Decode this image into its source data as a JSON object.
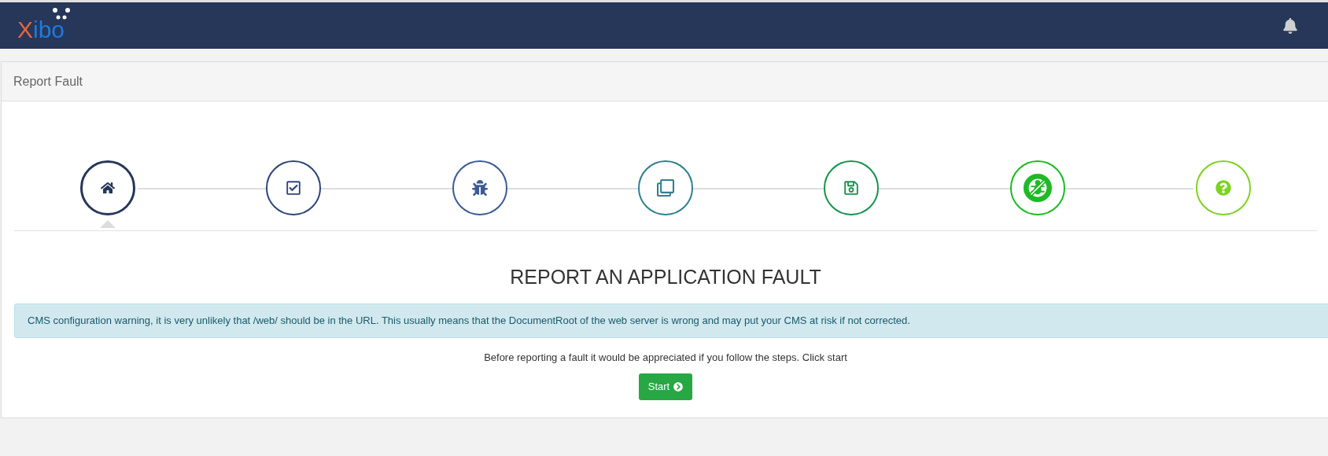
{
  "navbar": {
    "logo": "Xibo"
  },
  "panel": {
    "title": "Report Fault"
  },
  "steps": [
    {
      "color": "#263759",
      "selected": true
    },
    {
      "color": "#2e4677",
      "selected": false
    },
    {
      "color": "#3d5a95",
      "selected": false
    },
    {
      "color": "#2f7f8f",
      "selected": false
    },
    {
      "color": "#16934f",
      "selected": false
    },
    {
      "color": "#1dba25",
      "selected": false
    },
    {
      "color": "#7ed321",
      "selected": false
    }
  ],
  "heading": "REPORT AN APPLICATION FAULT",
  "alert": "CMS configuration warning, it is very unlikely that /web/ should be in the URL. This usually means that the DocumentRoot of the web server is wrong and may put your CMS at risk if not corrected.",
  "intro": "Before reporting a fault it would be appreciated if you follow the steps. Click start",
  "start_button": "Start"
}
